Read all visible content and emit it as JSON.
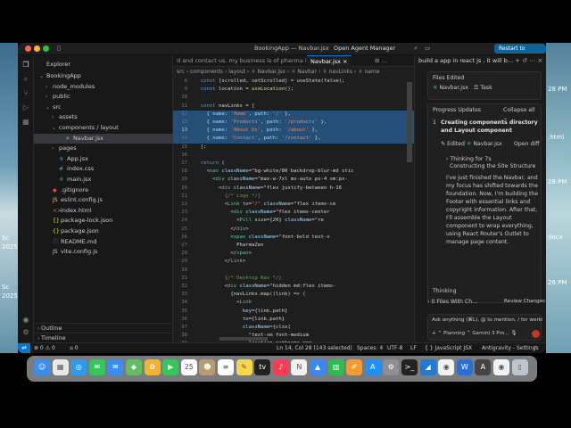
{
  "window": {
    "title": "BookingApp — Navbar.jsx",
    "agent_manager": "Open Agent Manager",
    "restart_label": "Restart to Update ↗"
  },
  "explorer": {
    "title": "Explorer",
    "items": [
      {
        "label": "BookingApp",
        "depth": 0,
        "chevron": "v",
        "kind": "folder"
      },
      {
        "label": "node_modules",
        "depth": 1,
        "chevron": ">",
        "kind": "folder"
      },
      {
        "label": "public",
        "depth": 1,
        "chevron": ">",
        "kind": "folder"
      },
      {
        "label": "src",
        "depth": 1,
        "chevron": "v",
        "kind": "folder"
      },
      {
        "label": "assets",
        "depth": 2,
        "chevron": ">",
        "kind": "folder"
      },
      {
        "label": "components / layout",
        "depth": 2,
        "chevron": "v",
        "kind": "folder"
      },
      {
        "label": "Navbar.jsx",
        "depth": 3,
        "chevron": "",
        "kind": "jsx",
        "selected": true
      },
      {
        "label": "pages",
        "depth": 2,
        "chevron": ">",
        "kind": "folder"
      },
      {
        "label": "App.jsx",
        "depth": 2,
        "chevron": "",
        "kind": "jsx"
      },
      {
        "label": "index.css",
        "depth": 2,
        "chevron": "",
        "kind": "css"
      },
      {
        "label": "main.jsx",
        "depth": 2,
        "chevron": "",
        "kind": "jsx"
      },
      {
        "label": ".gitignore",
        "depth": 1,
        "chevron": "",
        "kind": "git"
      },
      {
        "label": "eslint.config.js",
        "depth": 1,
        "chevron": "",
        "kind": "js"
      },
      {
        "label": "index.html",
        "depth": 1,
        "chevron": "",
        "kind": "html"
      },
      {
        "label": "package-lock.json",
        "depth": 1,
        "chevron": "",
        "kind": "json"
      },
      {
        "label": "package.json",
        "depth": 1,
        "chevron": "",
        "kind": "json"
      },
      {
        "label": "README.md",
        "depth": 1,
        "chevron": "",
        "kind": "md"
      },
      {
        "label": "vite.config.js",
        "depth": 1,
        "chevron": "",
        "kind": "js"
      }
    ],
    "outline_label": "Outline",
    "timeline_label": "Timeline"
  },
  "editor": {
    "tabs": [
      {
        "label": "d and contact us. my business is of pharma industry",
        "active": false
      },
      {
        "label": "Navbar.jsx  ×",
        "active": true
      },
      {
        "label": "⊞ …",
        "active": false
      }
    ],
    "breadcrumb": "src › components › layout › ⚛ Navbar.jsx › ⚛ Navbar › ⚛ navLinks › ⚛ name",
    "code_lines": [
      {
        "n": "8",
        "text": "  const [scrolled, setScrolled] = useState(false);",
        "hl": false
      },
      {
        "n": "9",
        "text": "  const location = useLocation();",
        "hl": false
      },
      {
        "n": "10",
        "text": "",
        "hl": false
      },
      {
        "n": "11",
        "text": "  const navLinks = [",
        "hl": false
      },
      {
        "n": "12",
        "text": "    { name: 'Home', path: '/' },",
        "hl": true
      },
      {
        "n": "13",
        "text": "    { name: 'Products', path: '/products' },",
        "hl": true
      },
      {
        "n": "13",
        "text": "    { name: 'About Us', path: '/about' },",
        "hl": true,
        "cur": true
      },
      {
        "n": "14",
        "text": "    { name: 'Contact', path: '/contact' },",
        "hl": true
      },
      {
        "n": "15",
        "text": "  ];",
        "hl": false
      },
      {
        "n": "16",
        "text": "",
        "hl": false
      },
      {
        "n": "17",
        "text": "  return (",
        "hl": false
      },
      {
        "n": "18",
        "text": "    <nav className=\"bg-white/80 backdrop-blur-md stic",
        "hl": false
      },
      {
        "n": "19",
        "text": "      <div className=\"max-w-7xl mx-auto px-4 sm:px-",
        "hl": false
      },
      {
        "n": "20",
        "text": "        <div className=\"flex justify-between h-16",
        "hl": false
      },
      {
        "n": "21",
        "text": "          {/* Logo */}",
        "hl": false
      },
      {
        "n": "22",
        "text": "          <Link to=\"/\" className=\"flex items-ce",
        "hl": false
      },
      {
        "n": "23",
        "text": "            <div className=\"flex items-center",
        "hl": false
      },
      {
        "n": "24",
        "text": "              <Pill size={20} className=\"re",
        "hl": false
      },
      {
        "n": "25",
        "text": "            </div>",
        "hl": false
      },
      {
        "n": "26",
        "text": "            <span className=\"font-bold text-x",
        "hl": false
      },
      {
        "n": "27",
        "text": "              PharmaZen",
        "hl": false
      },
      {
        "n": "28",
        "text": "            </span>",
        "hl": false
      },
      {
        "n": "29",
        "text": "          </Link>",
        "hl": false
      },
      {
        "n": "30",
        "text": "",
        "hl": false
      },
      {
        "n": "31",
        "text": "          {/* Desktop Nav */}",
        "hl": false
      },
      {
        "n": "32",
        "text": "          <div className=\"hidden md:flex items-",
        "hl": false
      },
      {
        "n": "33",
        "text": "            {navLinks.map((link) => (",
        "hl": false
      },
      {
        "n": "34",
        "text": "              <Link",
        "hl": false
      },
      {
        "n": "35",
        "text": "                key={link.path}",
        "hl": false
      },
      {
        "n": "36",
        "text": "                to={link.path}",
        "hl": false
      },
      {
        "n": "37",
        "text": "                className={clsx(",
        "hl": false
      },
      {
        "n": "38",
        "text": "                  \"text-sm font-medium",
        "hl": false
      },
      {
        "n": "39",
        "text": "                  location.pathname ===",
        "hl": false
      }
    ]
  },
  "agent": {
    "tab_label": "build a app in react js . it will b…",
    "files_edited_label": "Files Edited",
    "files_edited_file": "Navbar.jsx",
    "task_label": "Task",
    "progress_label": "Progress Updates",
    "collapse_label": "Collapse all",
    "step_number": "1",
    "step_title": "Creating components directory and Layout component",
    "edited_label": "Edited",
    "edited_file": "Navbar.jsx",
    "open_diff_label": "Open diff",
    "thinking_for": "Thinking for 7s",
    "thinking_sub": "Constructing the Site Structure",
    "message": "I've just finished the Navbar, and my focus has shifted towards the foundation. Now, I'm building the Footer with essential links and copyright information. After that, I'll assemble the Layout component to wrap everything, using React Router's Outlet to manage page content.",
    "thinking_label": "Thinking",
    "files_changed_label": "0 Files With Ch…",
    "review_changes_label": "Review Changes",
    "input_placeholder": "Ask anything (⌘L), @ to mention, / for workf",
    "mode_label": "Planning",
    "model_label": "Gemini 3 Pro…"
  },
  "statusbar": {
    "errors": "⊗ 0  ⚠ 0",
    "ports": "⌂ 0",
    "cursor": "Ln 14, Col 28 (143 selected)",
    "spaces": "Spaces: 4",
    "encoding": "UTF-8",
    "eol": "LF",
    "language": "{ } JavaScript JSX",
    "settings": "Antigravity - Settings"
  },
  "desktop": {
    "labels": [
      "Sc",
      "2025-",
      "Sc",
      "2025-"
    ],
    "right_labels": [
      "28 PM",
      ".html",
      "28 PM",
      "docx",
      "26 PM"
    ]
  },
  "dock": {
    "icons": [
      {
        "name": "finder-icon",
        "color": "#3b8ef0",
        "glyph": "☺"
      },
      {
        "name": "launchpad-icon",
        "color": "#e8e8e8",
        "glyph": "▦"
      },
      {
        "name": "safari-icon",
        "color": "#2d9cf0",
        "glyph": "◎"
      },
      {
        "name": "messages-icon",
        "color": "#34c759",
        "glyph": "✉"
      },
      {
        "name": "mail-icon",
        "color": "#3a8df5",
        "glyph": "✉"
      },
      {
        "name": "maps-icon",
        "color": "#5fbf5f",
        "glyph": "◆"
      },
      {
        "name": "photos-icon",
        "color": "#f2b233",
        "glyph": "✿"
      },
      {
        "name": "facetime-icon",
        "color": "#34c759",
        "glyph": "▶"
      },
      {
        "name": "calendar-icon",
        "color": "#ffffff",
        "glyph": "25"
      },
      {
        "name": "contacts-icon",
        "color": "#b89b72",
        "glyph": "☻"
      },
      {
        "name": "reminders-icon",
        "color": "#ffffff",
        "glyph": "≡"
      },
      {
        "name": "notes-icon",
        "color": "#f7d64a",
        "glyph": "✎"
      },
      {
        "name": "tv-icon",
        "color": "#222222",
        "glyph": "tv"
      },
      {
        "name": "music-icon",
        "color": "#fa3c55",
        "glyph": "♪"
      },
      {
        "name": "news-icon",
        "color": "#f0f0f0",
        "glyph": "N"
      },
      {
        "name": "keynote-icon",
        "color": "#3a86ff",
        "glyph": "▲"
      },
      {
        "name": "numbers-icon",
        "color": "#2dbd4e",
        "glyph": "▥"
      },
      {
        "name": "pages-icon",
        "color": "#f29b33",
        "glyph": "✐"
      },
      {
        "name": "appstore-icon",
        "color": "#1e90ff",
        "glyph": "A"
      },
      {
        "name": "settings-icon",
        "color": "#8e8e93",
        "glyph": "⚙"
      },
      {
        "name": "terminal-icon",
        "color": "#222222",
        "glyph": ">_"
      },
      {
        "name": "vscode-icon",
        "color": "#1f7ad6",
        "glyph": "◢"
      },
      {
        "name": "chrome-icon",
        "color": "#f2f2f2",
        "glyph": "◉"
      },
      {
        "name": "word-icon",
        "color": "#2b6fd6",
        "glyph": "W"
      },
      {
        "name": "antigravity-icon",
        "color": "#444444",
        "glyph": "A"
      },
      {
        "name": "chrome-2-icon",
        "color": "#f2f2f2",
        "glyph": "◉"
      },
      {
        "name": "trash-icon",
        "color": "#bfc5cc",
        "glyph": "▯"
      }
    ]
  },
  "colors": {
    "accent": "#0078d4",
    "selection": "#264f78"
  }
}
